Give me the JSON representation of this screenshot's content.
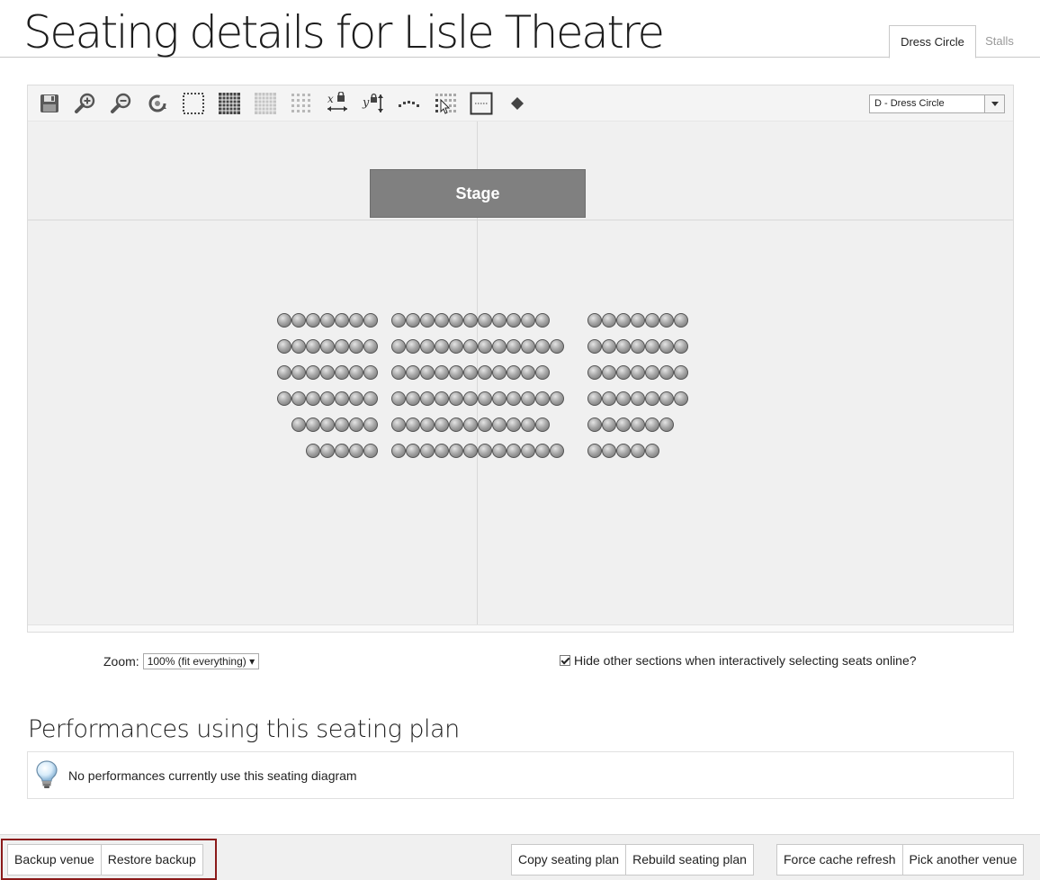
{
  "header": {
    "title": "Seating details for Lisle Theatre",
    "tabs": [
      {
        "label": "Dress Circle",
        "active": true
      },
      {
        "label": "Stalls",
        "active": false
      }
    ]
  },
  "toolbar": {
    "icons": [
      "save-icon",
      "zoom-in-icon",
      "zoom-out-icon",
      "refresh-icon",
      "select-box-icon",
      "grid-full-icon",
      "grid-light-icon",
      "grid-sparse-icon",
      "lock-x-icon",
      "lock-y-icon",
      "curve-row-icon",
      "grid-pointer-icon",
      "label-box-icon",
      "diamond-icon"
    ],
    "section_select": "D - Dress Circle"
  },
  "canvas": {
    "stage_label": "Stage",
    "seat_blocks": [
      {
        "block": "left",
        "row_counts": [
          7,
          7,
          7,
          7,
          6,
          5
        ]
      },
      {
        "block": "center",
        "row_counts": [
          11,
          12,
          11,
          12,
          11,
          12
        ]
      },
      {
        "block": "right",
        "row_counts": [
          7,
          7,
          7,
          7,
          6,
          5
        ]
      }
    ]
  },
  "options": {
    "zoom_label": "Zoom:",
    "zoom_value": "100% (fit everything) ▾",
    "hide_label": "Hide other sections when interactively selecting seats online?",
    "hide_checked": true
  },
  "performances": {
    "title": "Performances using this seating plan",
    "message": "No performances currently use this seating diagram"
  },
  "footer": {
    "backup_label": "Backup venue",
    "restore_label": "Restore backup",
    "copy_label": "Copy seating plan",
    "rebuild_label": "Rebuild seating plan",
    "force_label": "Force cache refresh",
    "pick_label": "Pick another venue"
  }
}
